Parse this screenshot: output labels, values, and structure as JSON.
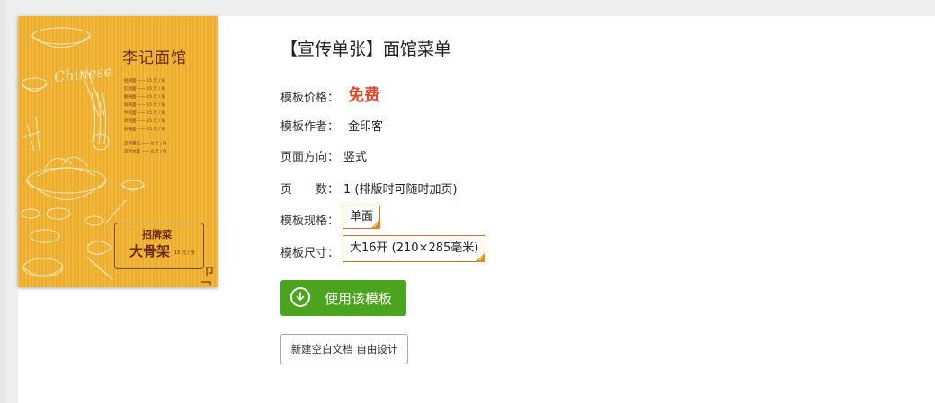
{
  "template": {
    "title": "【宣传单张】面馆菜单",
    "preview": {
      "shop_name": "李记面馆",
      "script_word": "Chinese",
      "menu_rows": [
        "招牌面 —— 15 元 / 份",
        "红烧面 —— 15 元 / 份",
        "酸辣面 —— 15 元 / 份",
        "排骨面 —— 15 元 / 份",
        "牛肉面 —— 15 元 / 份",
        "鸡汤面 —— 15 元 / 份",
        "杂酱面 —— 15 元 / 份"
      ],
      "extra_rows": [
        "凉拌黄瓜 —— 9 元 / 份",
        "凉拌木耳 —— 8 元 / 份"
      ],
      "signature_heading": "招牌菜",
      "signature_dish": "大骨架",
      "signature_price": "15 元 / 份"
    },
    "price_label": "模板价格：",
    "price_value": "免费",
    "author_label": "模板作者：",
    "author_value": "金印客",
    "orientation_label": "页面方向：",
    "orientation_value": "竖式",
    "pages_label": "页　　数：",
    "pages_value": "1 (排版时可随时加页)",
    "spec_label": "模板规格：",
    "spec_option": "单面",
    "size_label": "模板尺寸：",
    "size_option": "大16开 (210×285毫米)",
    "use_button": "使用该模板",
    "blank_button": "新建空白文档 自由设计"
  },
  "colors": {
    "preview_bg": "#f2b330",
    "price_red": "#e3462b",
    "primary_green": "#4ba41e",
    "option_border": "#c8742a"
  },
  "icons": {
    "use_button_icon": "download-circle-icon",
    "option_selected_icon": "check-corner-icon"
  }
}
